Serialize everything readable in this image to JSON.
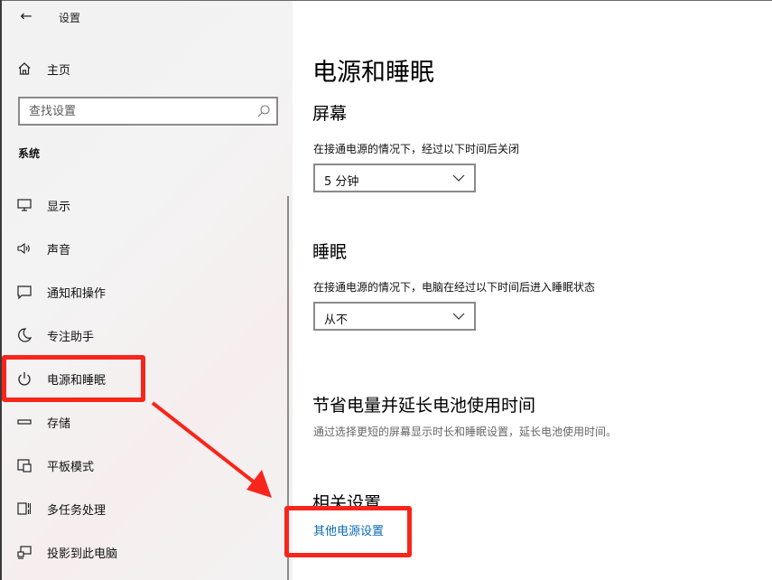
{
  "window": {
    "title": "设置",
    "back_label": "←"
  },
  "sidebar": {
    "home_label": "主页",
    "search": {
      "placeholder": "查找设置",
      "value": ""
    },
    "section_label": "系统",
    "items": [
      {
        "label": "显示",
        "icon": "monitor-icon"
      },
      {
        "label": "声音",
        "icon": "speaker-icon"
      },
      {
        "label": "通知和操作",
        "icon": "notification-icon"
      },
      {
        "label": "专注助手",
        "icon": "moon-icon"
      },
      {
        "label": "电源和睡眠",
        "icon": "power-icon",
        "selected": true
      },
      {
        "label": "存储",
        "icon": "storage-icon"
      },
      {
        "label": "平板模式",
        "icon": "tablet-icon"
      },
      {
        "label": "多任务处理",
        "icon": "multitask-icon"
      },
      {
        "label": "投影到此电脑",
        "icon": "project-icon"
      }
    ]
  },
  "main": {
    "title": "电源和睡眠",
    "screen": {
      "heading": "屏幕",
      "description": "在接通电源的情况下，经过以下时间后关闭",
      "dropdown_value": "5 分钟"
    },
    "sleep": {
      "heading": "睡眠",
      "description": "在接通电源的情况下，电脑在经过以下时间后进入睡眠状态",
      "dropdown_value": "从不"
    },
    "battery": {
      "heading": "节省电量并延长电池使用时间",
      "description": "通过选择更短的屏幕显示时长和睡眠设置，延长电池使用时间。"
    },
    "related": {
      "heading": "相关设置",
      "link": "其他电源设置"
    }
  },
  "colors": {
    "highlight": "#f7251b",
    "link": "#0a6bb0",
    "sidebar_bg": "#f2f2f2"
  }
}
